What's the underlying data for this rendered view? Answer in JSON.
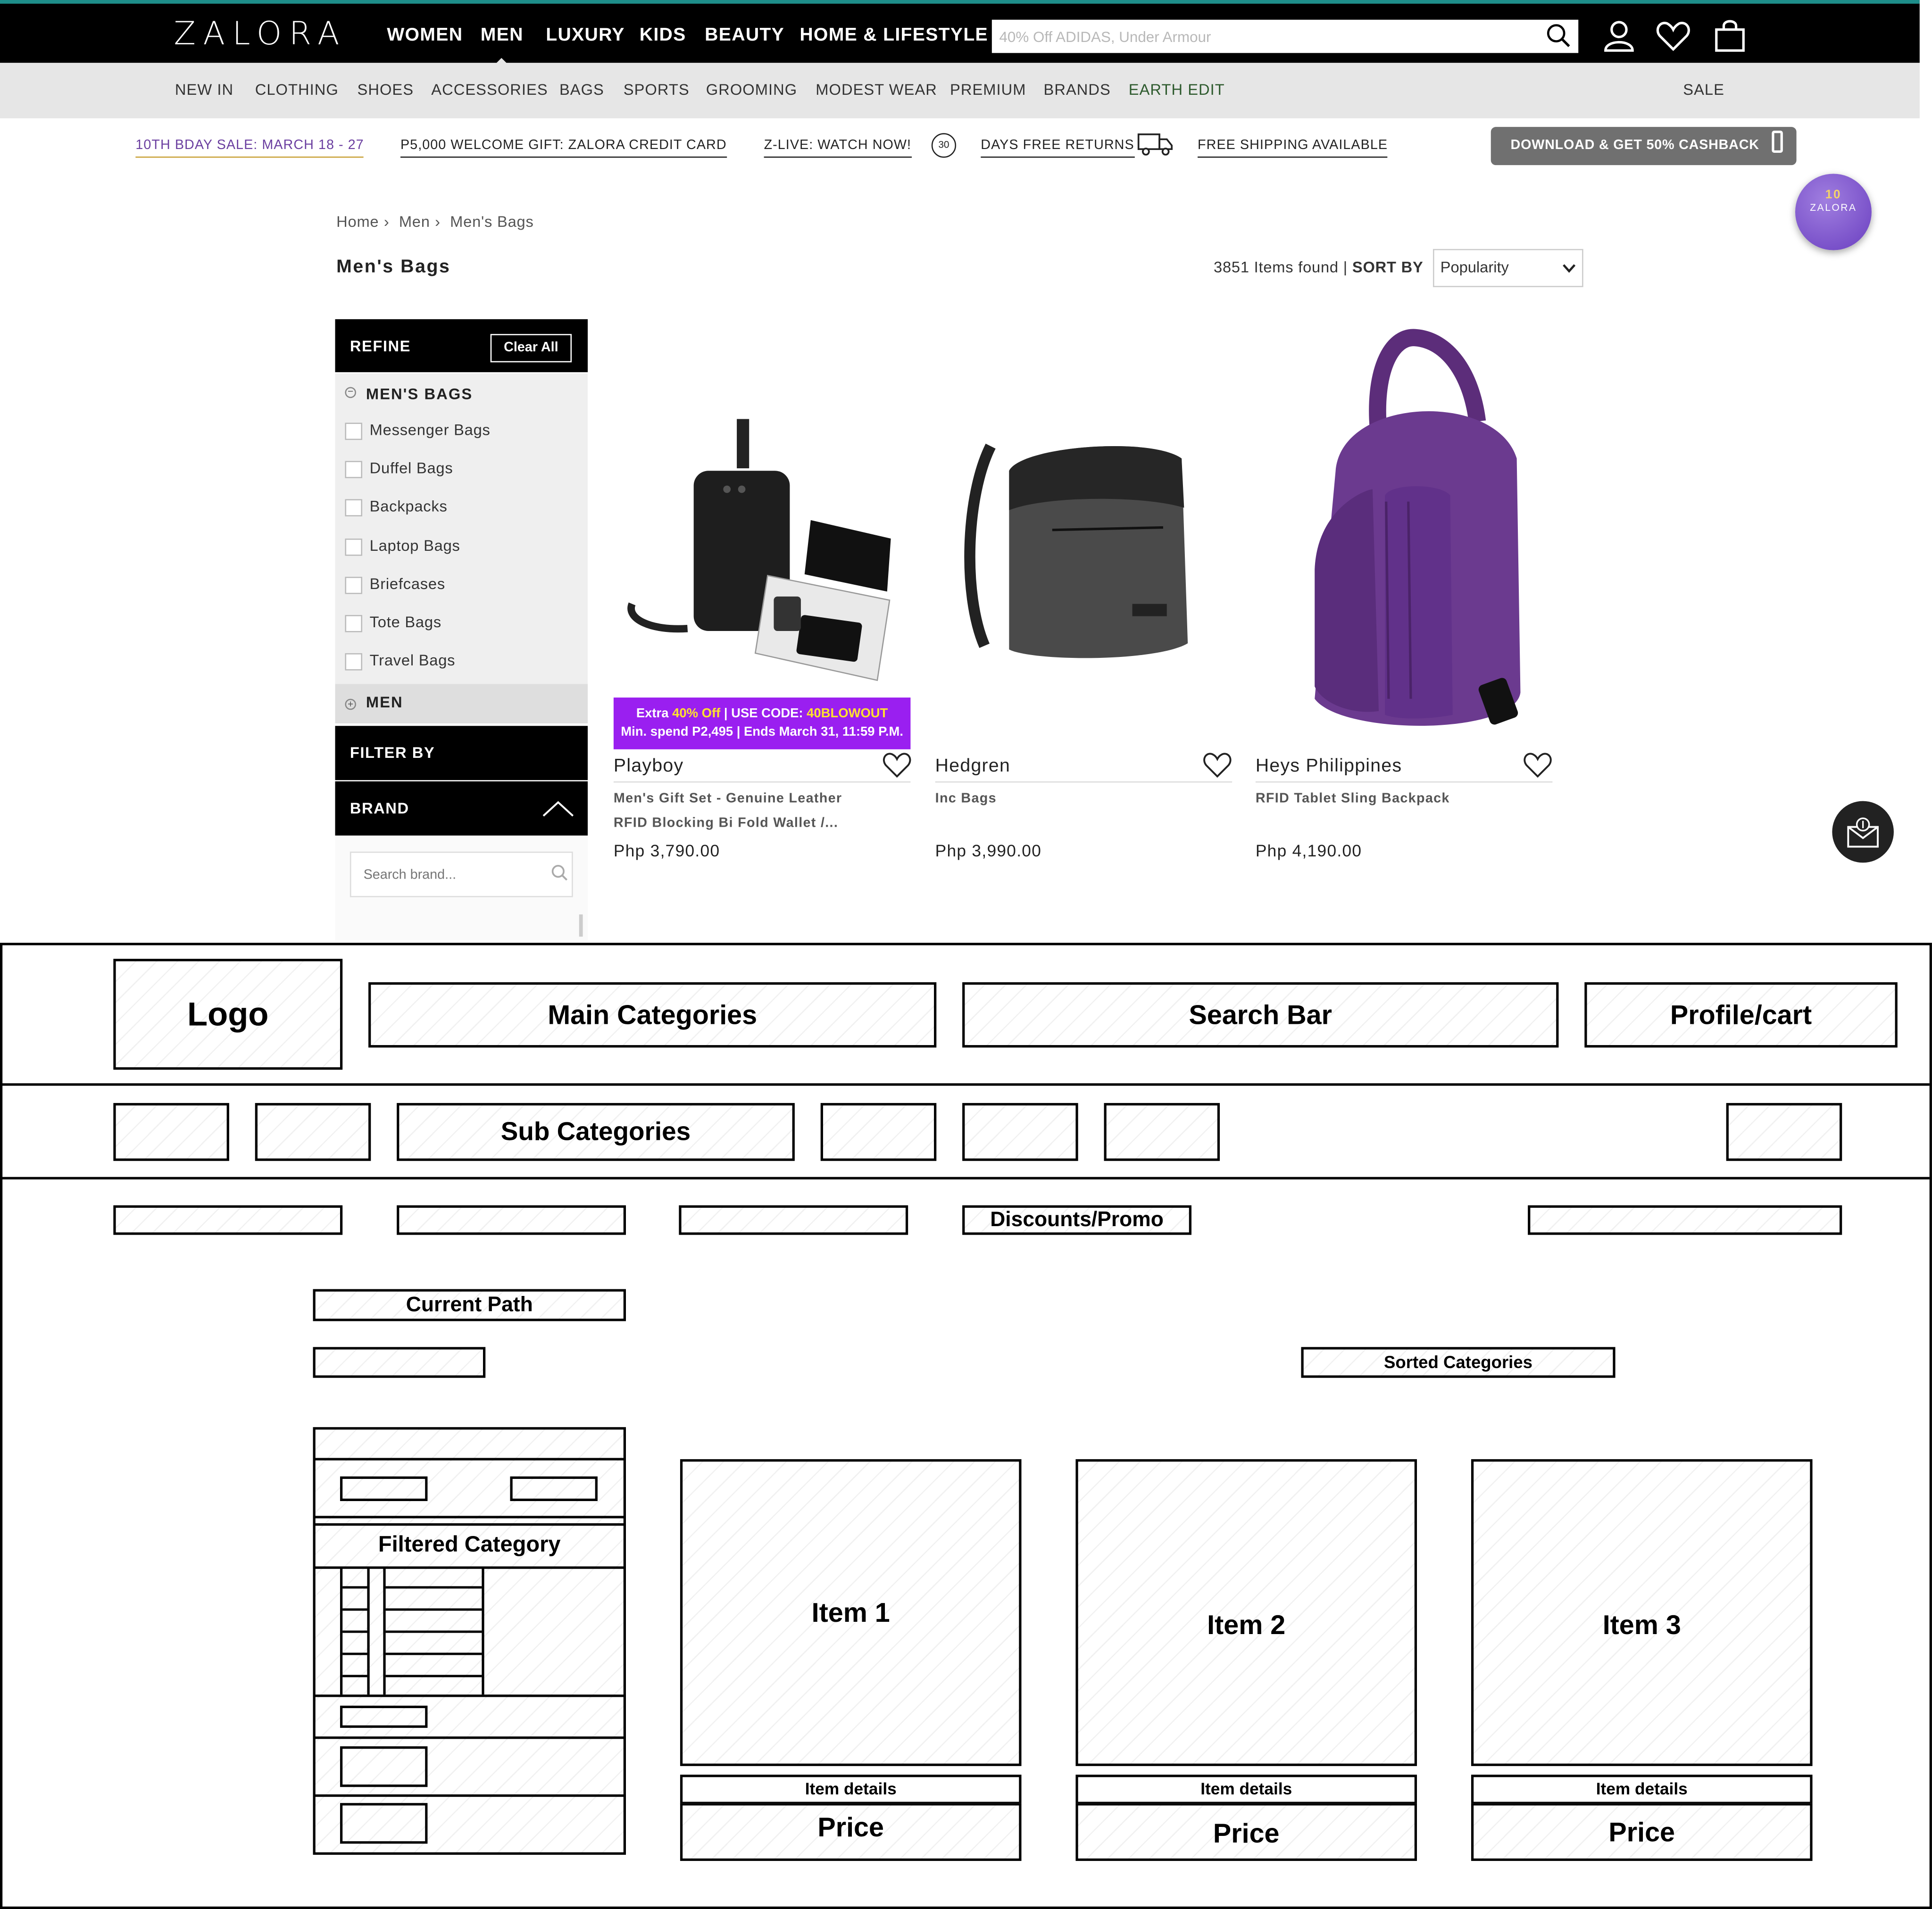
{
  "header": {
    "logo": "ZALORA",
    "main_nav": [
      "WOMEN",
      "MEN",
      "LUXURY",
      "KIDS",
      "BEAUTY",
      "HOME & LIFESTYLE"
    ],
    "active_nav": "MEN",
    "search_placeholder": "40% Off ADIDAS, Under Armour",
    "icons": [
      "search-icon",
      "user-icon",
      "heart-icon",
      "bag-icon"
    ]
  },
  "subnav": {
    "items": [
      "NEW IN",
      "CLOTHING",
      "SHOES",
      "ACCESSORIES",
      "BAGS",
      "SPORTS",
      "GROOMING",
      "MODEST WEAR",
      "PREMIUM",
      "BRANDS",
      "EARTH EDIT"
    ],
    "sale": "SALE"
  },
  "promos": {
    "items": [
      "10TH BDAY SALE: MARCH 18 - 27",
      "P5,000 WELCOME GIFT: ZALORA CREDIT CARD",
      "Z-LIVE: WATCH NOW!",
      "DAYS FREE RETURNS",
      "FREE SHIPPING AVAILABLE"
    ],
    "returns_days": "30",
    "download_button": "DOWNLOAD & GET 50% CASHBACK",
    "badge_number": "10",
    "badge_text": "ZALORA"
  },
  "breadcrumb": [
    "Home",
    "Men",
    "Men's Bags"
  ],
  "page_title": "Men's Bags",
  "results": {
    "count_text": "3851 Items found |",
    "sort_label": "SORT BY",
    "sort_value": "Popularity"
  },
  "sidebar": {
    "refine_label": "REFINE",
    "clear_all": "Clear All",
    "category_heading": "MEN'S BAGS",
    "categories": [
      "Messenger Bags",
      "Duffel Bags",
      "Backpacks",
      "Laptop Bags",
      "Briefcases",
      "Tote Bags",
      "Travel Bags"
    ],
    "parent_category": "MEN",
    "filter_by": "FILTER BY",
    "brand_label": "BRAND",
    "brand_search_placeholder": "Search brand..."
  },
  "products": [
    {
      "brand": "Playboy",
      "desc1": "Men's Gift Set - Genuine Leather",
      "desc2": "RFID Blocking Bi Fold Wallet /...",
      "price": "Php 3,790.00"
    },
    {
      "brand": "Hedgren",
      "desc1": "Inc Bags",
      "desc2": "",
      "price": "Php 3,990.00"
    },
    {
      "brand": "Heys Philippines",
      "desc1": "RFID Tablet Sling Backpack",
      "desc2": "",
      "price": "Php 4,190.00"
    }
  ],
  "promo_banner": {
    "pre": "Extra ",
    "discount": "40% Off",
    "mid": " | USE CODE: ",
    "code": "40BLOWOUT",
    "line2": "Min. spend P2,495 | Ends March 31, 11:59 P.M."
  },
  "colors": {
    "accent_purple": "#9a1ff0",
    "promo_yellow": "#ffe22e",
    "teal_line": "#1e8e8a"
  },
  "wireframe": {
    "logo": "Logo",
    "main_categories": "Main Categories",
    "search_bar": "Search Bar",
    "profile_cart": "Profile/cart",
    "sub_categories": "Sub Categories",
    "discounts": "Discounts/Promo",
    "current_path": "Current Path",
    "sorted_categories": "Sorted Categories",
    "filtered_category": "Filtered Category",
    "items": [
      {
        "label": "Item 1",
        "details": "Item details",
        "price": "Price"
      },
      {
        "label": "Item 2",
        "details": "Item details",
        "price": "Price"
      },
      {
        "label": "Item 3",
        "details": "Item details",
        "price": "Price"
      }
    ]
  }
}
